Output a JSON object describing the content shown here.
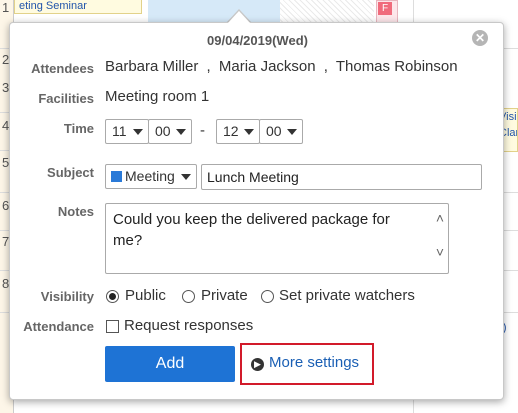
{
  "background": {
    "hours": [
      "1",
      "2",
      "3",
      "4",
      "5",
      "6",
      "7",
      "8"
    ],
    "top_event": "eting Seminar",
    "pink_badge": "F",
    "right_event_lines": [
      "Visi",
      "Clar"
    ],
    "right_link": "ri)"
  },
  "popup": {
    "date": "09/04/2019(Wed)",
    "close_icon": "close-icon",
    "labels": {
      "attendees": "Attendees",
      "facilities": "Facilities",
      "time": "Time",
      "subject": "Subject",
      "notes": "Notes",
      "visibility": "Visibility",
      "attendance": "Attendance"
    },
    "attendees": [
      "Barbara Miller",
      "Maria Jackson",
      "Thomas Robinson"
    ],
    "attendee_separator": ",",
    "facility": "Meeting room 1",
    "time": {
      "start_hour": "11",
      "start_minute": "00",
      "separator": "-",
      "end_hour": "12",
      "end_minute": "00"
    },
    "subject": {
      "category": "Meeting",
      "category_color": "#2a7ad8",
      "title": "Lunch Meeting"
    },
    "notes": "Could you keep the delivered package for me?",
    "visibility": {
      "options": [
        "Public",
        "Private",
        "Set private watchers"
      ],
      "selected": "Public"
    },
    "attendance": {
      "checkbox_label": "Request responses",
      "checked": false
    },
    "add_button": "Add",
    "more_settings": "More settings",
    "highlight_color": "#d21a2a",
    "accent_color": "#1e73d5"
  }
}
